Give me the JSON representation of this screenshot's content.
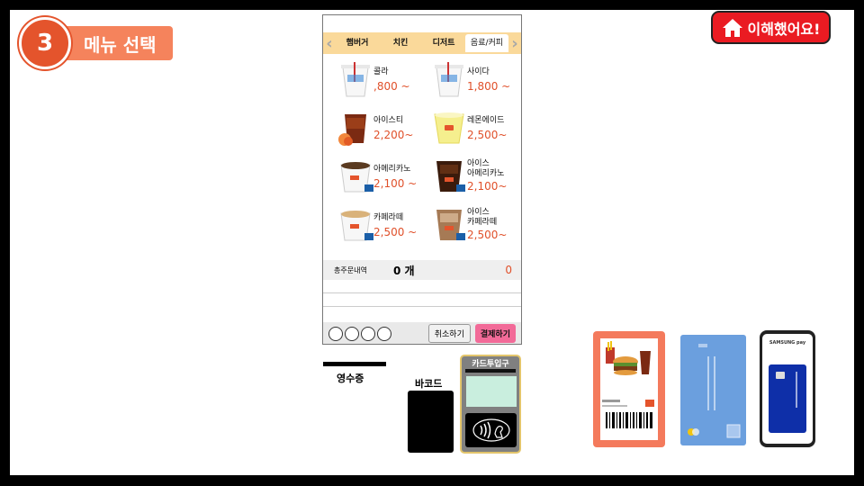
{
  "step": {
    "number": "3",
    "label": "메뉴 선택"
  },
  "understood_button": {
    "label": "이해했어요!"
  },
  "kiosk": {
    "tabs": [
      "햄버거",
      "치킨",
      "디저트",
      "음료/커피"
    ],
    "active_tab": "음료/커피",
    "items": [
      {
        "name": "콜라",
        "price": ",800 ~"
      },
      {
        "name": "사이다",
        "price": "1,800 ~"
      },
      {
        "name": "아이스티",
        "price": "2,200~"
      },
      {
        "name": "레몬에이드",
        "price": "2,500~"
      },
      {
        "name": "아메리카노",
        "price": "2,100 ~"
      },
      {
        "name": "아이스",
        "name2": "아메리카노",
        "price": "2,100~"
      },
      {
        "name": "카페라떼",
        "price": "2,500 ~"
      },
      {
        "name": "아이스",
        "name2": "카페라떼",
        "price": "2,500~"
      }
    ],
    "order": {
      "label": "총주문내역",
      "count": "0 개",
      "total": "0"
    },
    "bottom": {
      "cancel": "취소하기",
      "pay": "결제하기"
    }
  },
  "hardware": {
    "receipt": "영수증",
    "barcode": "바코드",
    "card_slot": "카드투입구"
  },
  "phone": {
    "brand": "SAMSUNG pay"
  },
  "colors": {
    "accent": "#e4542c",
    "price": "#e0502a",
    "pay_button": "#f26a98",
    "tab_bar": "#fad99a"
  }
}
